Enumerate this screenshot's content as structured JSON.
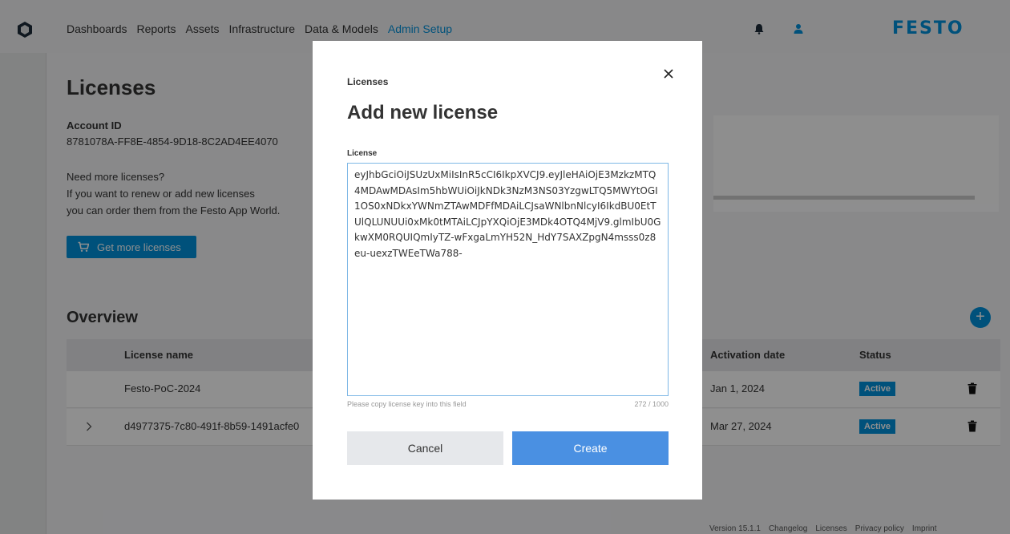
{
  "nav": {
    "items": [
      "Dashboards",
      "Reports",
      "Assets",
      "Infrastructure",
      "Data & Models",
      "Admin Setup"
    ],
    "active": "Admin Setup"
  },
  "brand": {
    "name": "FESTO",
    "color": "#0091dc"
  },
  "icons": {
    "app": "app-logo-icon",
    "bell": "bell-icon",
    "user": "user-icon",
    "cart": "cart-icon",
    "trash": "trash-icon",
    "chevron": "chevron-right-icon",
    "close": "close-icon"
  },
  "page": {
    "title": "Licenses",
    "account_label": "Account ID",
    "account_id": "8781078A-FF8E-4854-9D18-8C2AD4EE4070",
    "more_heading": "Need more licenses?",
    "more_line1": "If you want to renew or add new licenses",
    "more_line2": "you can order them from the Festo App World.",
    "get_more_label": "Get more licenses"
  },
  "overview": {
    "title": "Overview",
    "add_label": "+",
    "columns": {
      "name": "License name",
      "activation": "Activation date",
      "status": "Status"
    },
    "rows": [
      {
        "name": "Festo-PoC-2024",
        "activation": "Jan 1, 2024",
        "status": "Active"
      },
      {
        "name": "d4977375-7c80-491f-8b59-1491acfe0",
        "activation": "Mar 27, 2024",
        "status": "Active"
      }
    ]
  },
  "footer": {
    "version": "Version 15.1.1",
    "links": [
      "Changelog",
      "Licenses",
      "Privacy policy",
      "Imprint"
    ]
  },
  "modal": {
    "kicker": "Licenses",
    "title": "Add new license",
    "field_label": "License",
    "license_value": "eyJhbGciOiJSUzUxMiIsInR5cCI6IkpXVCJ9.eyJleHAiOjE3MzkzMTQ4MDAwMDAsIm5hbWUiOiJkNDk3NzM3NS03YzgwLTQ5MWYtOGI1OS0xNDkxYWNmZTAwMDFfMDAiLCJsaWNlbnNlcyI6IkdBU0EtTUlQLUNUUi0xMk0tMTAiLCJpYXQiOjE3MDk4OTQ4MjV9.glmIbU0GkwXM0RQUIQmIyTZ-wFxgaLmYH52N_HdY7SAXZpgN4msss0z8eu-uexzTWEeTWa788-",
    "hint": "Please copy license key into this field",
    "char_count": "272 / 1000",
    "cancel_label": "Cancel",
    "create_label": "Create"
  }
}
